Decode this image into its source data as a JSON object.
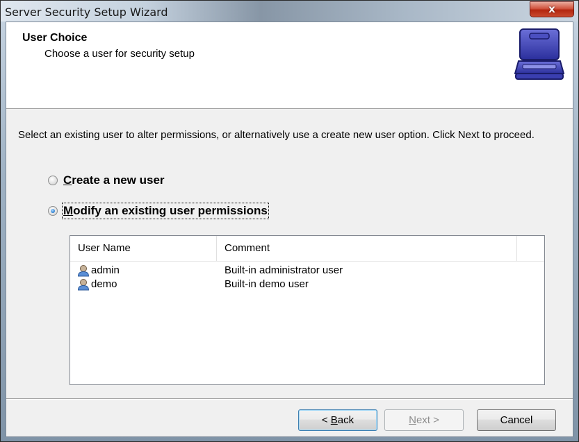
{
  "window": {
    "title": "Server Security Setup Wizard",
    "close_glyph": "x"
  },
  "header": {
    "title": "User Choice",
    "subtitle": "Choose a user for security setup",
    "icon": "briefcase-icon"
  },
  "instructions": "Select an existing user to alter permissions, or alternatively use a create new user option. Click Next to proceed.",
  "options": {
    "create": {
      "label_accel": "C",
      "label_rest": "reate a new user",
      "checked": false
    },
    "modify": {
      "label_accel": "M",
      "label_rest": "odify an existing user permissions",
      "checked": true
    }
  },
  "users_table": {
    "columns": [
      "User Name",
      "Comment"
    ],
    "rows": [
      {
        "icon": "user-icon",
        "name": "admin",
        "comment": "Built-in administrator user"
      },
      {
        "icon": "user-icon",
        "name": "demo",
        "comment": "Built-in demo user"
      }
    ]
  },
  "buttons": {
    "back": {
      "prefix": "< ",
      "accel": "B",
      "rest": "ack"
    },
    "next": {
      "accel": "N",
      "rest": "ext >",
      "enabled": false
    },
    "cancel": {
      "label": "Cancel"
    }
  }
}
